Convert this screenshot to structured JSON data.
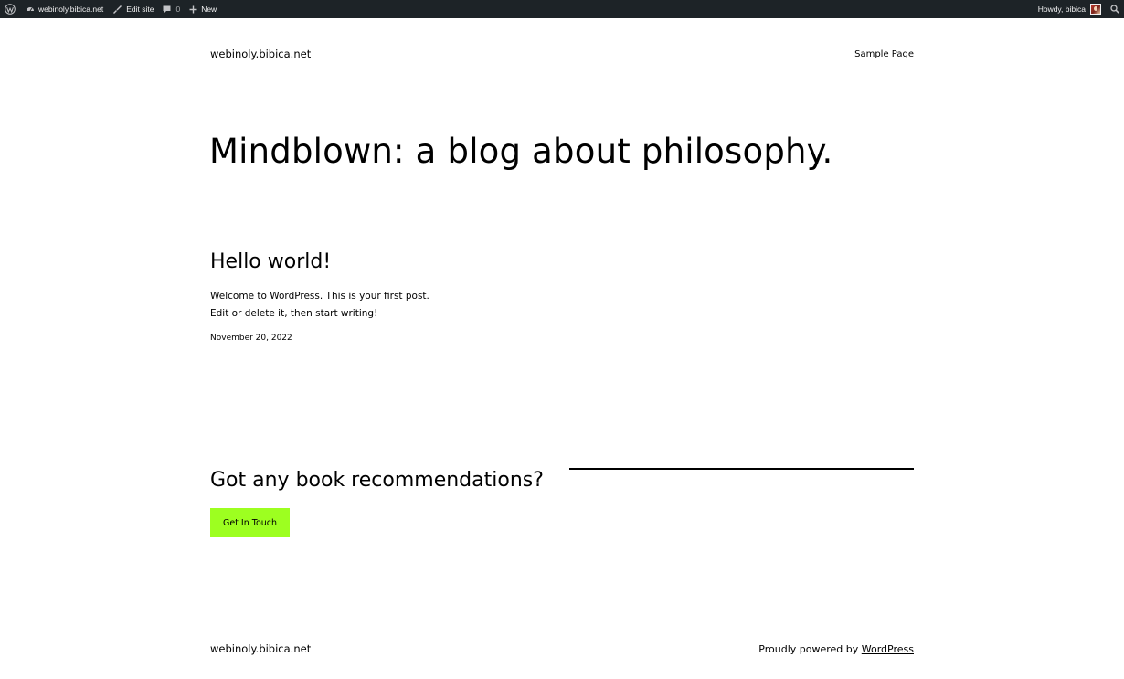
{
  "admin_bar": {
    "site_name": "webinoly.bibica.net",
    "edit_site": "Edit site",
    "comments_count": "0",
    "new_label": "New",
    "howdy": "Howdy, bibica"
  },
  "header": {
    "site_title": "webinoly.bibica.net",
    "nav": {
      "sample_page": "Sample Page"
    }
  },
  "hero": {
    "title": "Mindblown: a blog about philosophy."
  },
  "post": {
    "title": "Hello world!",
    "excerpt": "Welcome to WordPress. This is your first post. Edit or delete it, then start writing!",
    "date": "November 20, 2022"
  },
  "cta": {
    "heading": "Got any book recommendations?",
    "button": "Get In Touch"
  },
  "footer": {
    "site_title": "webinoly.bibica.net",
    "credit_prefix": "Proudly powered by",
    "credit_link": "WordPress"
  },
  "colors": {
    "admin_bar_bg": "#1d2327",
    "button_bg": "#9dff20",
    "text": "#000000",
    "background": "#ffffff"
  }
}
